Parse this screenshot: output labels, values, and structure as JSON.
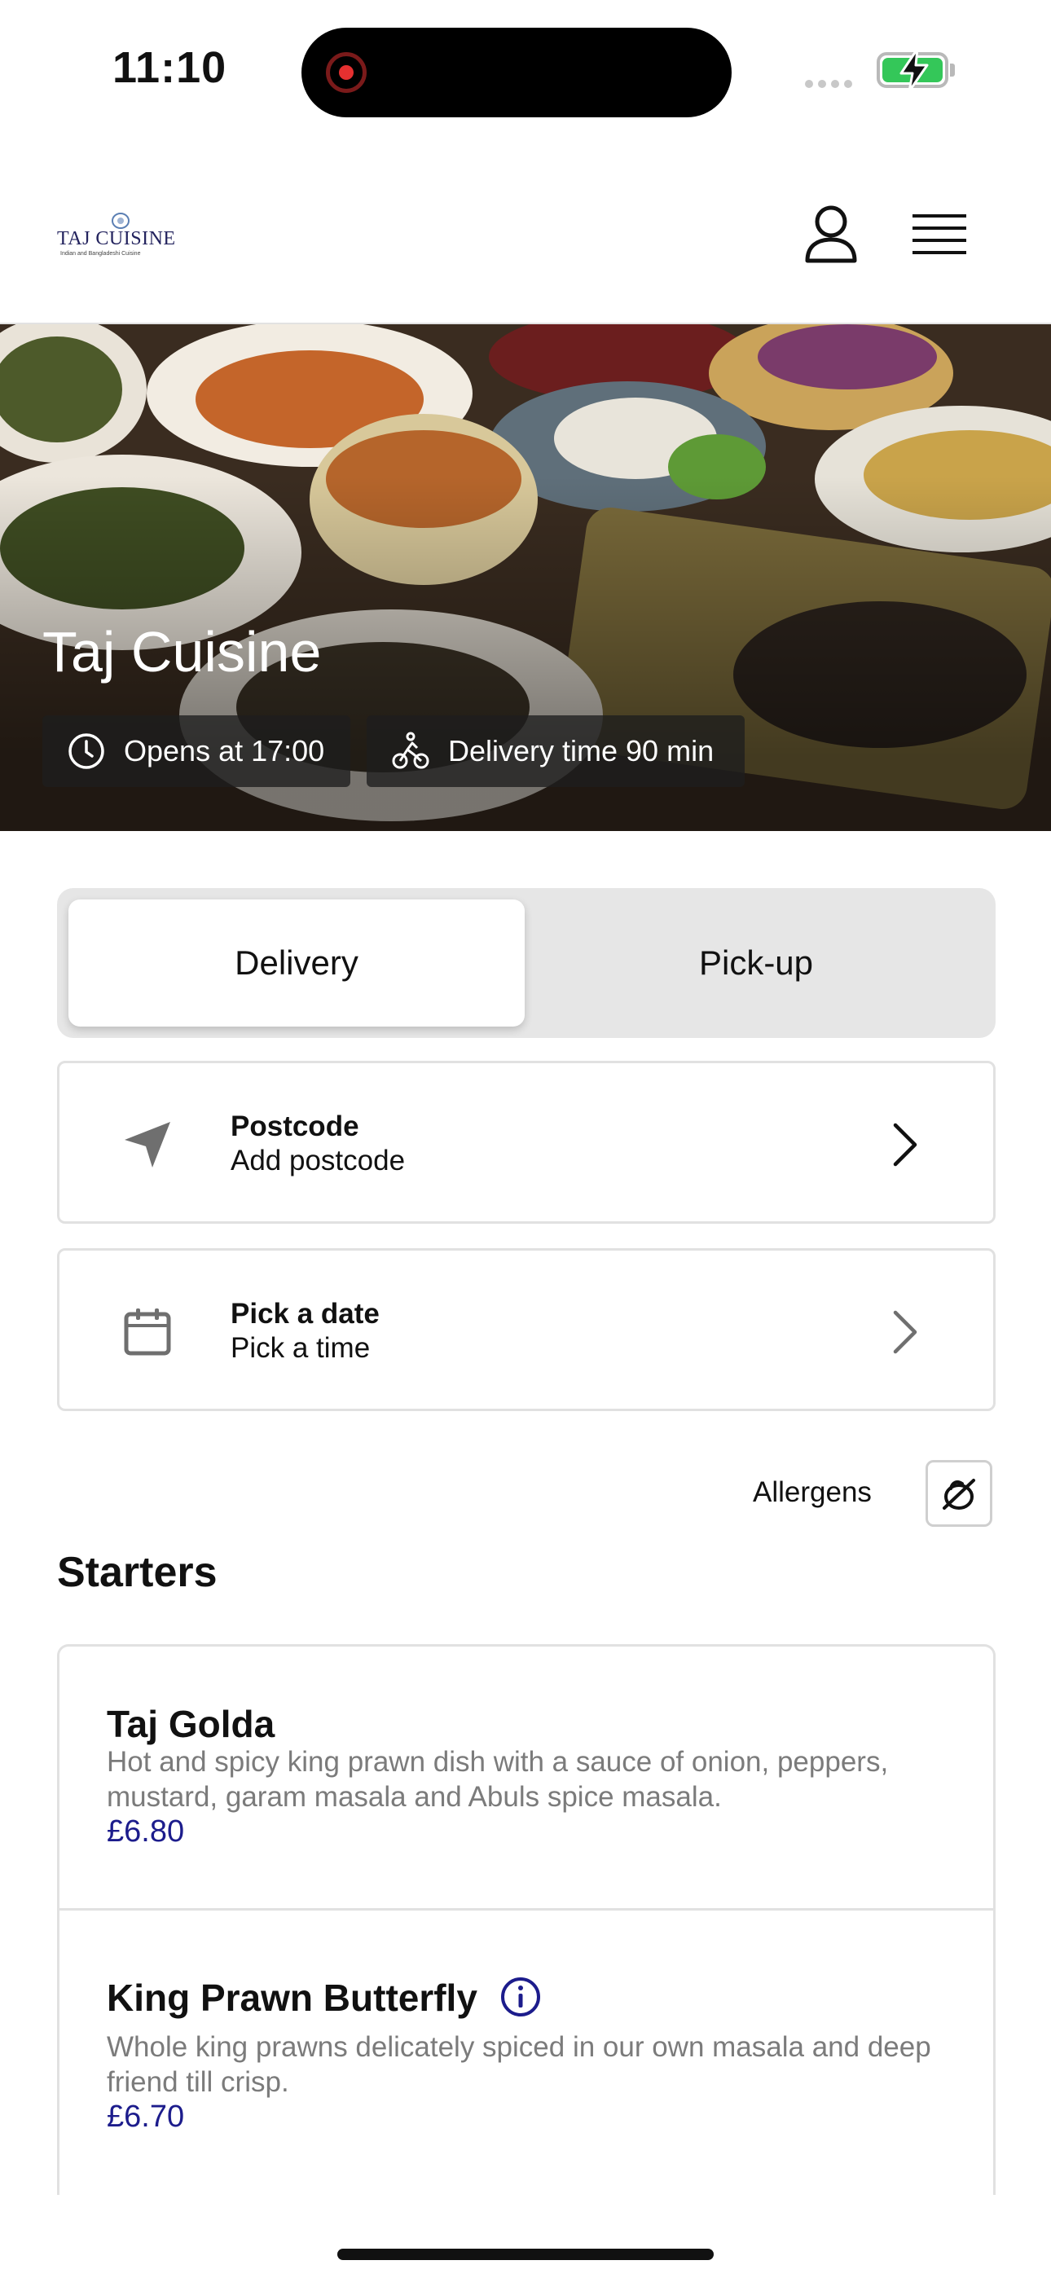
{
  "status_bar": {
    "time": "11:10"
  },
  "header": {
    "logo_text": "TAJ CUISINE",
    "logo_subtext": "Indian and Bangladeshi Cuisine",
    "icons": [
      "user-icon",
      "menu-icon"
    ]
  },
  "hero": {
    "title": "Taj Cuisine",
    "opens": "Opens at 17:00",
    "delivery_time": "Delivery time 90 min"
  },
  "order_mode": {
    "options": [
      "Delivery",
      "Pick-up"
    ],
    "selected": "Delivery"
  },
  "postcode_card": {
    "title": "Postcode",
    "value": "Add postcode",
    "icon": "location-arrow-icon"
  },
  "schedule_card": {
    "title": "Pick a date",
    "value": "Pick a time",
    "icon": "calendar-icon"
  },
  "allergens": {
    "label": "Allergens",
    "icon": "allergens-icon"
  },
  "menu": {
    "section_title": "Starters",
    "items": [
      {
        "name": "Taj Golda",
        "description": "Hot and spicy king prawn dish with a sauce of onion, peppers, mustard, garam masala and Abuls spice masala.",
        "price": "£6.80"
      },
      {
        "name": "King Prawn Butterfly",
        "description": "Whole king prawns delicately spiced in our own masala and deep friend till crisp.",
        "price": "£6.70",
        "has_info": true
      }
    ]
  },
  "colors": {
    "accent": "#1c1c8c",
    "battery": "#34c759",
    "segment_bg": "#e6e6e6"
  }
}
